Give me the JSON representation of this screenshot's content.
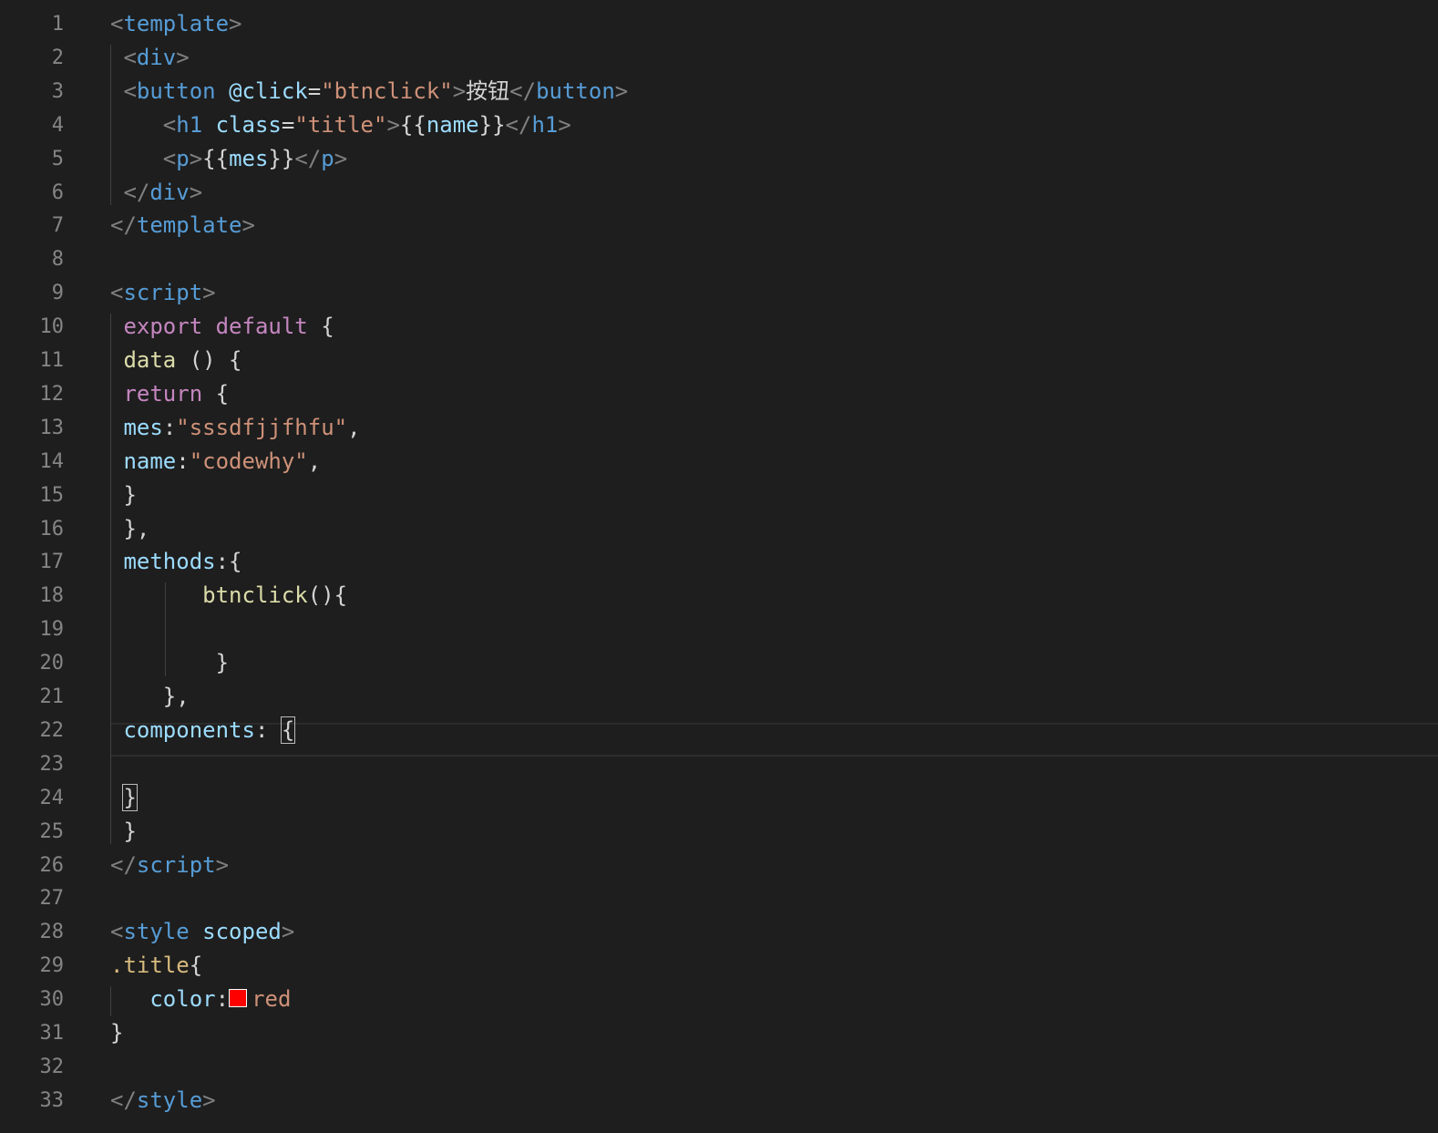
{
  "lines": [
    {
      "number": "1",
      "tokens": [
        {
          "t": "bracket",
          "v": "<"
        },
        {
          "t": "tag",
          "v": "template"
        },
        {
          "t": "bracket",
          "v": ">"
        }
      ]
    },
    {
      "number": "2",
      "tokens": [
        {
          "t": "plain",
          "v": " "
        },
        {
          "t": "bracket",
          "v": "<"
        },
        {
          "t": "tag",
          "v": "div"
        },
        {
          "t": "bracket",
          "v": ">"
        }
      ]
    },
    {
      "number": "3",
      "tokens": [
        {
          "t": "plain",
          "v": " "
        },
        {
          "t": "bracket",
          "v": "<"
        },
        {
          "t": "tag",
          "v": "button"
        },
        {
          "t": "plain",
          "v": " "
        },
        {
          "t": "attr",
          "v": "@click"
        },
        {
          "t": "plain",
          "v": "="
        },
        {
          "t": "str",
          "v": "\"btnclick\""
        },
        {
          "t": "bracket",
          "v": ">"
        },
        {
          "t": "plain",
          "v": "按钮"
        },
        {
          "t": "bracket",
          "v": "</"
        },
        {
          "t": "tag",
          "v": "button"
        },
        {
          "t": "bracket",
          "v": ">"
        }
      ]
    },
    {
      "number": "4",
      "tokens": [
        {
          "t": "plain",
          "v": "    "
        },
        {
          "t": "bracket",
          "v": "<"
        },
        {
          "t": "tag",
          "v": "h1"
        },
        {
          "t": "plain",
          "v": " "
        },
        {
          "t": "attr",
          "v": "class"
        },
        {
          "t": "plain",
          "v": "="
        },
        {
          "t": "str",
          "v": "\"title\""
        },
        {
          "t": "bracket",
          "v": ">"
        },
        {
          "t": "plain",
          "v": "{{"
        },
        {
          "t": "prop",
          "v": "name"
        },
        {
          "t": "plain",
          "v": "}}"
        },
        {
          "t": "bracket",
          "v": "</"
        },
        {
          "t": "tag",
          "v": "h1"
        },
        {
          "t": "bracket",
          "v": ">"
        }
      ]
    },
    {
      "number": "5",
      "tokens": [
        {
          "t": "plain",
          "v": "    "
        },
        {
          "t": "bracket",
          "v": "<"
        },
        {
          "t": "tag",
          "v": "p"
        },
        {
          "t": "bracket",
          "v": ">"
        },
        {
          "t": "plain",
          "v": "{{"
        },
        {
          "t": "prop",
          "v": "mes"
        },
        {
          "t": "plain",
          "v": "}}"
        },
        {
          "t": "bracket",
          "v": "</"
        },
        {
          "t": "tag",
          "v": "p"
        },
        {
          "t": "bracket",
          "v": ">"
        }
      ]
    },
    {
      "number": "6",
      "tokens": [
        {
          "t": "plain",
          "v": " "
        },
        {
          "t": "bracket",
          "v": "</"
        },
        {
          "t": "tag",
          "v": "div"
        },
        {
          "t": "bracket",
          "v": ">"
        }
      ]
    },
    {
      "number": "7",
      "tokens": [
        {
          "t": "bracket",
          "v": "</"
        },
        {
          "t": "tag",
          "v": "template"
        },
        {
          "t": "bracket",
          "v": ">"
        }
      ]
    },
    {
      "number": "8",
      "tokens": []
    },
    {
      "number": "9",
      "tokens": [
        {
          "t": "bracket",
          "v": "<"
        },
        {
          "t": "tag",
          "v": "script"
        },
        {
          "t": "bracket",
          "v": ">"
        }
      ]
    },
    {
      "number": "10",
      "tokens": [
        {
          "t": "plain",
          "v": " "
        },
        {
          "t": "kw",
          "v": "export"
        },
        {
          "t": "plain",
          "v": " "
        },
        {
          "t": "kw",
          "v": "default"
        },
        {
          "t": "plain",
          "v": " {"
        }
      ]
    },
    {
      "number": "11",
      "tokens": [
        {
          "t": "plain",
          "v": " "
        },
        {
          "t": "fn",
          "v": "data"
        },
        {
          "t": "plain",
          "v": " () {"
        }
      ]
    },
    {
      "number": "12",
      "tokens": [
        {
          "t": "plain",
          "v": " "
        },
        {
          "t": "kw",
          "v": "return"
        },
        {
          "t": "plain",
          "v": " {"
        }
      ]
    },
    {
      "number": "13",
      "tokens": [
        {
          "t": "plain",
          "v": " "
        },
        {
          "t": "prop",
          "v": "mes"
        },
        {
          "t": "plain",
          "v": ":"
        },
        {
          "t": "str",
          "v": "\"sssdfjjfhfu\""
        },
        {
          "t": "plain",
          "v": ","
        }
      ]
    },
    {
      "number": "14",
      "tokens": [
        {
          "t": "plain",
          "v": " "
        },
        {
          "t": "prop",
          "v": "name"
        },
        {
          "t": "plain",
          "v": ":"
        },
        {
          "t": "str",
          "v": "\"codewhy\""
        },
        {
          "t": "plain",
          "v": ","
        }
      ]
    },
    {
      "number": "15",
      "tokens": [
        {
          "t": "plain",
          "v": " }"
        }
      ]
    },
    {
      "number": "16",
      "tokens": [
        {
          "t": "plain",
          "v": " },"
        }
      ]
    },
    {
      "number": "17",
      "tokens": [
        {
          "t": "plain",
          "v": " "
        },
        {
          "t": "prop",
          "v": "methods"
        },
        {
          "t": "plain",
          "v": ":{"
        }
      ]
    },
    {
      "number": "18",
      "tokens": [
        {
          "t": "plain",
          "v": "       "
        },
        {
          "t": "fn",
          "v": "btnclick"
        },
        {
          "t": "plain",
          "v": "(){"
        }
      ]
    },
    {
      "number": "19",
      "tokens": []
    },
    {
      "number": "20",
      "tokens": [
        {
          "t": "plain",
          "v": "        }"
        }
      ]
    },
    {
      "number": "21",
      "tokens": [
        {
          "t": "plain",
          "v": "    },"
        }
      ]
    },
    {
      "number": "22",
      "tokens": [
        {
          "t": "plain",
          "v": " "
        },
        {
          "t": "prop",
          "v": "components"
        },
        {
          "t": "plain",
          "v": ": "
        },
        {
          "t": "cursor",
          "v": "{"
        }
      ]
    },
    {
      "number": "23",
      "tokens": []
    },
    {
      "number": "24",
      "tokens": [
        {
          "t": "plain",
          "v": " "
        },
        {
          "t": "cursor",
          "v": "}"
        }
      ]
    },
    {
      "number": "25",
      "tokens": [
        {
          "t": "plain",
          "v": " }"
        }
      ]
    },
    {
      "number": "26",
      "tokens": [
        {
          "t": "bracket",
          "v": "</"
        },
        {
          "t": "tag",
          "v": "script"
        },
        {
          "t": "bracket",
          "v": ">"
        }
      ]
    },
    {
      "number": "27",
      "tokens": []
    },
    {
      "number": "28",
      "tokens": [
        {
          "t": "bracket",
          "v": "<"
        },
        {
          "t": "tag",
          "v": "style"
        },
        {
          "t": "plain",
          "v": " "
        },
        {
          "t": "attr",
          "v": "scoped"
        },
        {
          "t": "bracket",
          "v": ">"
        }
      ]
    },
    {
      "number": "29",
      "tokens": [
        {
          "t": "sel",
          "v": ".title"
        },
        {
          "t": "plain",
          "v": "{"
        }
      ]
    },
    {
      "number": "30",
      "tokens": [
        {
          "t": "plain",
          "v": "   "
        },
        {
          "t": "prop",
          "v": "color"
        },
        {
          "t": "plain",
          "v": ":"
        },
        {
          "t": "swatch",
          "v": "#ff0000"
        },
        {
          "t": "val",
          "v": "red"
        }
      ]
    },
    {
      "number": "31",
      "tokens": [
        {
          "t": "plain",
          "v": "}"
        }
      ]
    },
    {
      "number": "32",
      "tokens": []
    },
    {
      "number": "33",
      "tokens": [
        {
          "t": "bracket",
          "v": "</"
        },
        {
          "t": "tag",
          "v": "style"
        },
        {
          "t": "bracket",
          "v": ">"
        }
      ]
    }
  ],
  "colors": {
    "background": "#1e1e1e",
    "gutter": "#858585",
    "tag": "#569cd6",
    "bracket": "#808080",
    "attribute": "#9cdcfe",
    "string": "#ce9178",
    "keyword": "#c586c0",
    "function": "#dcdcaa",
    "selector": "#d7ba7d",
    "swatch_red": "#ff0000"
  }
}
